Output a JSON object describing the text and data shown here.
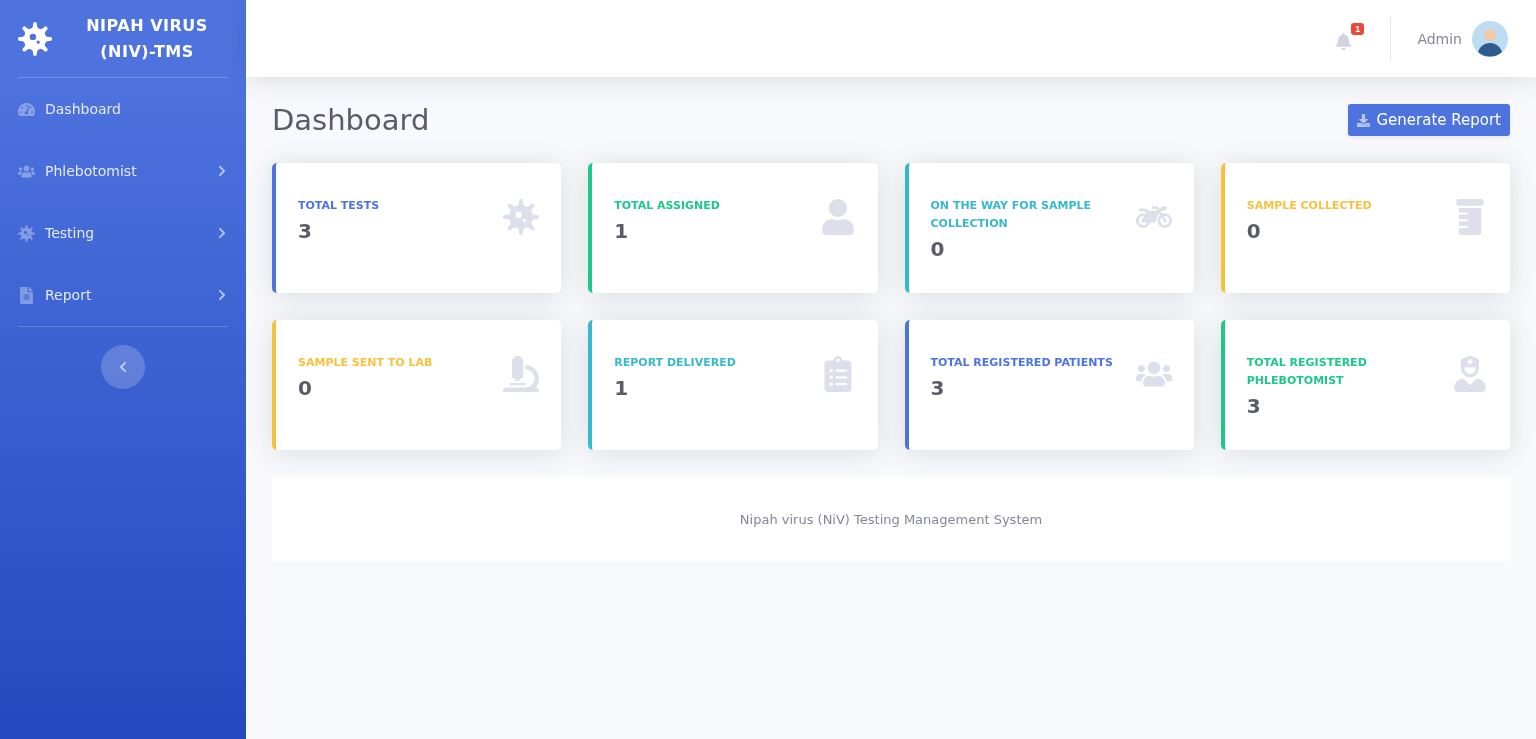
{
  "brand": {
    "title": "NIPAH VIRUS (NIV)-TMS"
  },
  "sidebar": {
    "items": [
      {
        "label": "Dashboard",
        "kind": "dashboard",
        "has_submenu": false
      },
      {
        "label": "Phlebotomist",
        "kind": "users",
        "has_submenu": true
      },
      {
        "label": "Testing",
        "kind": "virus",
        "has_submenu": true
      },
      {
        "label": "Report",
        "kind": "file",
        "has_submenu": true
      }
    ]
  },
  "topbar": {
    "notification_count": "1",
    "user_name": "Admin"
  },
  "page": {
    "title": "Dashboard",
    "button": "Generate Report"
  },
  "cards": [
    {
      "label": "TOTAL TESTS",
      "value": "3",
      "color": "#4e73df",
      "kind": "virus"
    },
    {
      "label": "TOTAL ASSIGNED",
      "value": "1",
      "color": "#1cc88a",
      "kind": "user"
    },
    {
      "label": "ON THE WAY FOR SAMPLE COLLECTION",
      "value": "0",
      "color": "#36b9cc",
      "kind": "motorcycle"
    },
    {
      "label": "SAMPLE COLLECTED",
      "value": "0",
      "color": "#f6c23e",
      "kind": "bottle"
    },
    {
      "label": "SAMPLE SENT TO LAB",
      "value": "0",
      "color": "#f6c23e",
      "kind": "microscope"
    },
    {
      "label": "REPORT DELIVERED",
      "value": "1",
      "color": "#36b9cc",
      "kind": "clipboard"
    },
    {
      "label": "TOTAL REGISTERED PATIENTS",
      "value": "3",
      "color": "#4e73df",
      "kind": "users"
    },
    {
      "label": "TOTAL REGISTERED PHLEBOTOMIST",
      "value": "3",
      "color": "#1cc88a",
      "kind": "nurse"
    }
  ],
  "footer": {
    "text": "Nipah virus (NiV) Testing Management System"
  }
}
